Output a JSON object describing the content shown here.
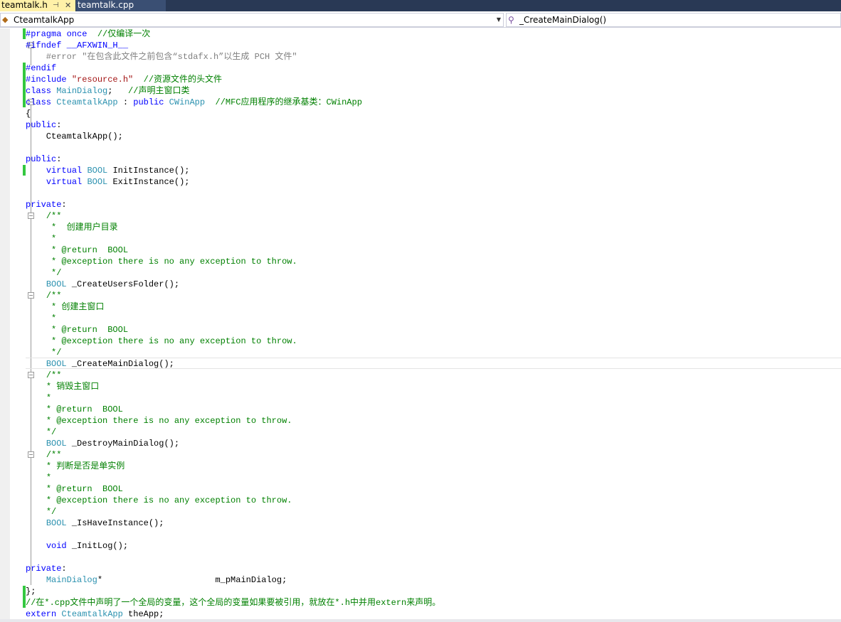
{
  "tabs": [
    {
      "label": "teamtalk.h",
      "active": true,
      "pin": "⊣",
      "close": "✕"
    },
    {
      "label": "teamtalk.cpp",
      "active": false
    }
  ],
  "nav": {
    "class_scope": "CteamtalkApp",
    "member_scope": "_CreateMainDialog()"
  },
  "colors": {
    "keyword": "#0000ff",
    "type": "#2b91af",
    "string": "#a31515",
    "comment": "#008000",
    "change_marker": "#34c840",
    "tab_active": "#fff1a8"
  },
  "code_lines": [
    [
      [
        "pp",
        "#pragma once"
      ],
      [
        "",
        "  "
      ],
      [
        "cm",
        "//仅编译一次"
      ]
    ],
    [
      [
        "pp",
        "#ifndef"
      ],
      [
        "",
        " "
      ],
      [
        "pp",
        "__AFXWIN_H__"
      ]
    ],
    [
      [
        "",
        ""
      ],
      [
        "gray",
        "    #error"
      ],
      [
        "gray",
        " \"在包含此文件之前包含“stdafx.h”以生成 PCH 文件\""
      ]
    ],
    [
      [
        "pp",
        "#endif"
      ]
    ],
    [
      [
        "pp",
        "#include"
      ],
      [
        "",
        " "
      ],
      [
        "str",
        "\"resource.h\""
      ],
      [
        "",
        "  "
      ],
      [
        "cm",
        "//资源文件的头文件"
      ]
    ],
    [
      [
        "kw",
        "class"
      ],
      [
        "",
        " "
      ],
      [
        "ty",
        "MainDialog"
      ],
      [
        "",
        ";   "
      ],
      [
        "cm",
        "//声明主窗口类"
      ]
    ],
    [
      [
        "kw",
        "class"
      ],
      [
        "",
        " "
      ],
      [
        "ty",
        "CteamtalkApp"
      ],
      [
        "",
        " : "
      ],
      [
        "kw",
        "public"
      ],
      [
        "",
        " "
      ],
      [
        "ty",
        "CWinApp"
      ],
      [
        "",
        "  "
      ],
      [
        "cm",
        "//MFC应用程序的继承基类：CWinApp"
      ]
    ],
    [
      [
        "",
        "{"
      ]
    ],
    [
      [
        "kw",
        "public"
      ],
      [
        "",
        ":"
      ]
    ],
    [
      [
        "",
        "    CteamtalkApp();"
      ]
    ],
    [
      [
        "",
        ""
      ]
    ],
    [
      [
        "kw",
        "public"
      ],
      [
        "",
        ":"
      ]
    ],
    [
      [
        "",
        "    "
      ],
      [
        "kw",
        "virtual"
      ],
      [
        "",
        " "
      ],
      [
        "ty",
        "BOOL"
      ],
      [
        "",
        " InitInstance();"
      ]
    ],
    [
      [
        "",
        "    "
      ],
      [
        "kw",
        "virtual"
      ],
      [
        "",
        " "
      ],
      [
        "ty",
        "BOOL"
      ],
      [
        "",
        " ExitInstance();"
      ]
    ],
    [
      [
        "",
        ""
      ]
    ],
    [
      [
        "kw",
        "private"
      ],
      [
        "",
        ":"
      ]
    ],
    [
      [
        "",
        "    "
      ],
      [
        "cm",
        "/**"
      ]
    ],
    [
      [
        "",
        "     "
      ],
      [
        "cm",
        "*  创建用户目录"
      ]
    ],
    [
      [
        "",
        "     "
      ],
      [
        "cm",
        "*"
      ]
    ],
    [
      [
        "",
        "     "
      ],
      [
        "cm",
        "* @return  BOOL"
      ]
    ],
    [
      [
        "",
        "     "
      ],
      [
        "cm",
        "* @exception there is no any exception to throw."
      ]
    ],
    [
      [
        "",
        "     "
      ],
      [
        "cm",
        "*/"
      ]
    ],
    [
      [
        "",
        "    "
      ],
      [
        "ty",
        "BOOL"
      ],
      [
        "",
        " _CreateUsersFolder();"
      ]
    ],
    [
      [
        "",
        "    "
      ],
      [
        "cm",
        "/**"
      ]
    ],
    [
      [
        "",
        "     "
      ],
      [
        "cm",
        "* 创建主窗口"
      ]
    ],
    [
      [
        "",
        "     "
      ],
      [
        "cm",
        "*"
      ]
    ],
    [
      [
        "",
        "     "
      ],
      [
        "cm",
        "* @return  BOOL"
      ]
    ],
    [
      [
        "",
        "     "
      ],
      [
        "cm",
        "* @exception there is no any exception to throw."
      ]
    ],
    [
      [
        "",
        "     "
      ],
      [
        "cm",
        "*/"
      ]
    ],
    [
      [
        "",
        "    "
      ],
      [
        "ty",
        "BOOL"
      ],
      [
        "",
        " _CreateMainDialog();"
      ]
    ],
    [
      [
        "",
        "    "
      ],
      [
        "cm",
        "/**"
      ]
    ],
    [
      [
        "",
        "    "
      ],
      [
        "cm",
        "* 销毁主窗口"
      ]
    ],
    [
      [
        "",
        "    "
      ],
      [
        "cm",
        "*"
      ]
    ],
    [
      [
        "",
        "    "
      ],
      [
        "cm",
        "* @return  BOOL"
      ]
    ],
    [
      [
        "",
        "    "
      ],
      [
        "cm",
        "* @exception there is no any exception to throw."
      ]
    ],
    [
      [
        "",
        "    "
      ],
      [
        "cm",
        "*/"
      ]
    ],
    [
      [
        "",
        "    "
      ],
      [
        "ty",
        "BOOL"
      ],
      [
        "",
        " _DestroyMainDialog();"
      ]
    ],
    [
      [
        "",
        "    "
      ],
      [
        "cm",
        "/**"
      ]
    ],
    [
      [
        "",
        "    "
      ],
      [
        "cm",
        "* 判断是否是单实例"
      ]
    ],
    [
      [
        "",
        "    "
      ],
      [
        "cm",
        "*"
      ]
    ],
    [
      [
        "",
        "    "
      ],
      [
        "cm",
        "* @return  BOOL"
      ]
    ],
    [
      [
        "",
        "    "
      ],
      [
        "cm",
        "* @exception there is no any exception to throw."
      ]
    ],
    [
      [
        "",
        "    "
      ],
      [
        "cm",
        "*/"
      ]
    ],
    [
      [
        "",
        "    "
      ],
      [
        "ty",
        "BOOL"
      ],
      [
        "",
        " _IsHaveInstance();"
      ]
    ],
    [
      [
        "",
        ""
      ]
    ],
    [
      [
        "",
        "    "
      ],
      [
        "kw",
        "void"
      ],
      [
        "",
        " _InitLog();"
      ]
    ],
    [
      [
        "",
        ""
      ]
    ],
    [
      [
        "kw",
        "private"
      ],
      [
        "",
        ":"
      ]
    ],
    [
      [
        "",
        "    "
      ],
      [
        "ty",
        "MainDialog"
      ],
      [
        "",
        "*                      m_pMainDialog;"
      ]
    ],
    [
      [
        "",
        "};"
      ]
    ],
    [
      [
        "cm",
        "//在*.cpp文件中声明了一个全局的变量，这个全局的变量如果要被引用，就放在*.h中并用extern来声明。"
      ]
    ],
    [
      [
        "kw",
        "extern"
      ],
      [
        "",
        " "
      ],
      [
        "ty",
        "CteamtalkApp"
      ],
      [
        "",
        " theApp;"
      ]
    ]
  ]
}
